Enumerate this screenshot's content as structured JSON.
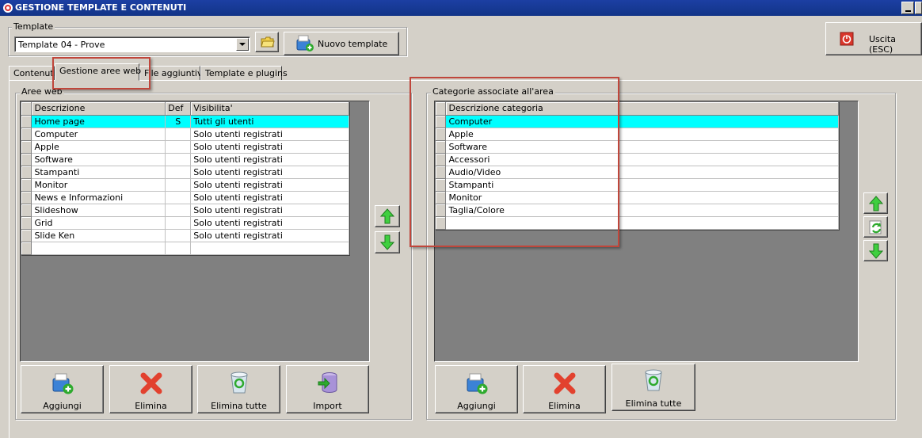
{
  "window": {
    "title": "GESTIONE TEMPLATE E CONTENUTI"
  },
  "template_group": {
    "label": "Template",
    "selected": "Template 04 - Prove",
    "new_button": "Nuovo template"
  },
  "exit_button": "Uscita (ESC)",
  "tabs": [
    {
      "label": "Contenuti"
    },
    {
      "label": "Gestione aree web"
    },
    {
      "label": "File aggiuntivi"
    },
    {
      "label": "Template e plugins"
    }
  ],
  "aree_web": {
    "label": "Aree web",
    "columns": [
      "Descrizione",
      "Def",
      "Visibilita'"
    ],
    "rows": [
      {
        "desc": "Home page",
        "def": "S",
        "vis": "Tutti gli utenti"
      },
      {
        "desc": "Computer",
        "def": "",
        "vis": "Solo utenti registrati"
      },
      {
        "desc": "Apple",
        "def": "",
        "vis": "Solo utenti registrati"
      },
      {
        "desc": "Software",
        "def": "",
        "vis": "Solo utenti registrati"
      },
      {
        "desc": "Stampanti",
        "def": "",
        "vis": "Solo utenti registrati"
      },
      {
        "desc": "Monitor",
        "def": "",
        "vis": "Solo utenti registrati"
      },
      {
        "desc": "News e Informazioni",
        "def": "",
        "vis": "Solo utenti registrati"
      },
      {
        "desc": "Slideshow",
        "def": "",
        "vis": "Solo utenti registrati"
      },
      {
        "desc": "Grid",
        "def": "",
        "vis": "Solo utenti registrati"
      },
      {
        "desc": "Slide Ken",
        "def": "",
        "vis": "Solo utenti registrati"
      }
    ],
    "buttons": [
      "Aggiungi",
      "Elimina",
      "Elimina tutte",
      "Import"
    ]
  },
  "categorie": {
    "label": "Categorie associate all'area",
    "columns": [
      "Descrizione categoria"
    ],
    "rows": [
      "Computer",
      "Apple",
      "Software",
      "Accessori",
      "Audio/Video",
      "Stampanti",
      "Monitor",
      "Taglia/Colore"
    ],
    "buttons": [
      "Aggiungi",
      "Elimina",
      "Elimina tutte"
    ]
  },
  "colors": {
    "selected_row": "#00ffff",
    "annotation": "#c0463b",
    "title_bar": "#123487"
  },
  "icons": {
    "window": "app-icon",
    "folder": "folder-icon",
    "new_template": "new-template-icon",
    "exit": "power-icon",
    "move_up": "arrow-up-icon",
    "move_down": "arrow-down-icon",
    "refresh": "refresh-icon",
    "add": "add-icon",
    "delete": "delete-x-icon",
    "delete_all": "recycle-bin-icon",
    "import": "database-import-icon"
  }
}
